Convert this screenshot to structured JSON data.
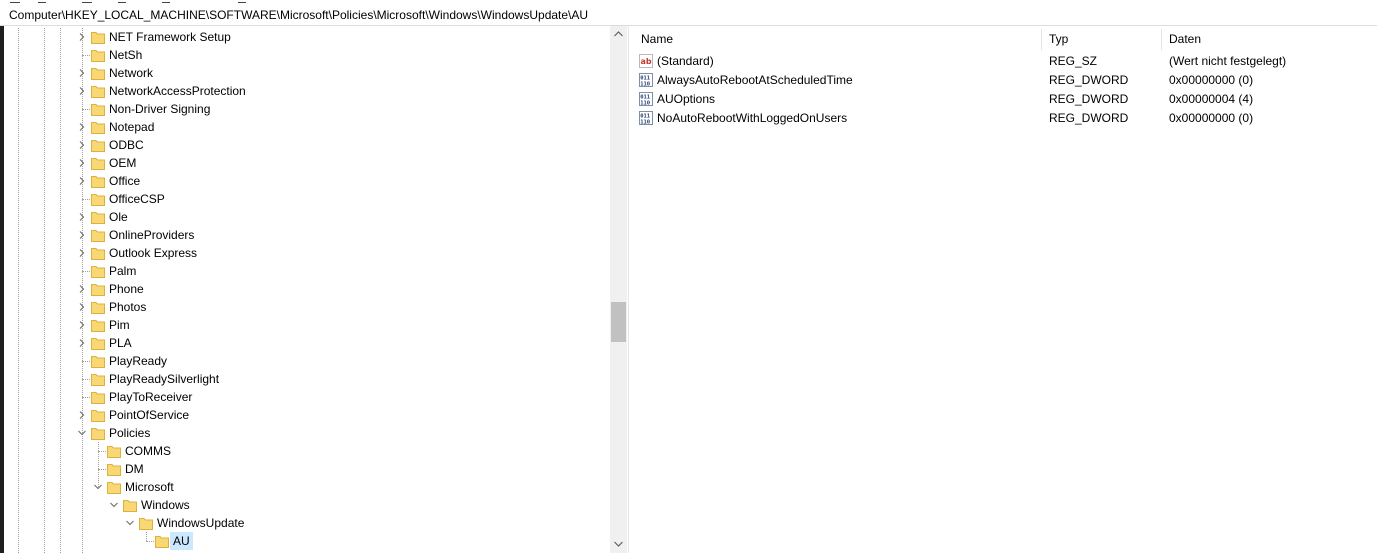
{
  "address": {
    "path": "Computer\\HKEY_LOCAL_MACHINE\\SOFTWARE\\Microsoft\\Policies\\Microsoft\\Windows\\WindowsUpdate\\AU"
  },
  "tree": {
    "items": [
      {
        "label": "NET Framework Setup",
        "expander": "collapsed"
      },
      {
        "label": "NetSh",
        "expander": "none"
      },
      {
        "label": "Network",
        "expander": "collapsed"
      },
      {
        "label": "NetworkAccessProtection",
        "expander": "collapsed"
      },
      {
        "label": "Non-Driver Signing",
        "expander": "none"
      },
      {
        "label": "Notepad",
        "expander": "collapsed"
      },
      {
        "label": "ODBC",
        "expander": "collapsed"
      },
      {
        "label": "OEM",
        "expander": "collapsed"
      },
      {
        "label": "Office",
        "expander": "collapsed"
      },
      {
        "label": "OfficeCSP",
        "expander": "none"
      },
      {
        "label": "Ole",
        "expander": "collapsed"
      },
      {
        "label": "OnlineProviders",
        "expander": "collapsed"
      },
      {
        "label": "Outlook Express",
        "expander": "collapsed"
      },
      {
        "label": "Palm",
        "expander": "none"
      },
      {
        "label": "Phone",
        "expander": "collapsed"
      },
      {
        "label": "Photos",
        "expander": "collapsed"
      },
      {
        "label": "Pim",
        "expander": "collapsed"
      },
      {
        "label": "PLA",
        "expander": "collapsed"
      },
      {
        "label": "PlayReady",
        "expander": "none"
      },
      {
        "label": "PlayReadySilverlight",
        "expander": "none"
      },
      {
        "label": "PlayToReceiver",
        "expander": "none"
      },
      {
        "label": "PointOfService",
        "expander": "collapsed"
      },
      {
        "label": "Policies",
        "expander": "expanded"
      },
      {
        "label": "COMMS",
        "expander": "none"
      },
      {
        "label": "DM",
        "expander": "none"
      },
      {
        "label": "Microsoft",
        "expander": "expanded"
      },
      {
        "label": "Windows",
        "expander": "expanded"
      },
      {
        "label": "WindowsUpdate",
        "expander": "expanded"
      },
      {
        "label": "AU",
        "expander": "none",
        "selected": true
      }
    ]
  },
  "values": {
    "columns": {
      "name": "Name",
      "type": "Typ",
      "data": "Daten"
    },
    "rows": [
      {
        "icon": "string-value-icon",
        "name": "(Standard)",
        "type": "REG_SZ",
        "data": "(Wert nicht festgelegt)"
      },
      {
        "icon": "binary-value-icon",
        "name": "AlwaysAutoRebootAtScheduledTime",
        "type": "REG_DWORD",
        "data": "0x00000000 (0)"
      },
      {
        "icon": "binary-value-icon",
        "name": "AUOptions",
        "type": "REG_DWORD",
        "data": "0x00000004 (4)"
      },
      {
        "icon": "binary-value-icon",
        "name": "NoAutoRebootWithLoggedOnUsers",
        "type": "REG_DWORD",
        "data": "0x00000000 (0)"
      }
    ]
  },
  "colors": {
    "folder": "#f8d775",
    "folder_dark": "#e0b03c",
    "selection": "#cce8ff"
  }
}
